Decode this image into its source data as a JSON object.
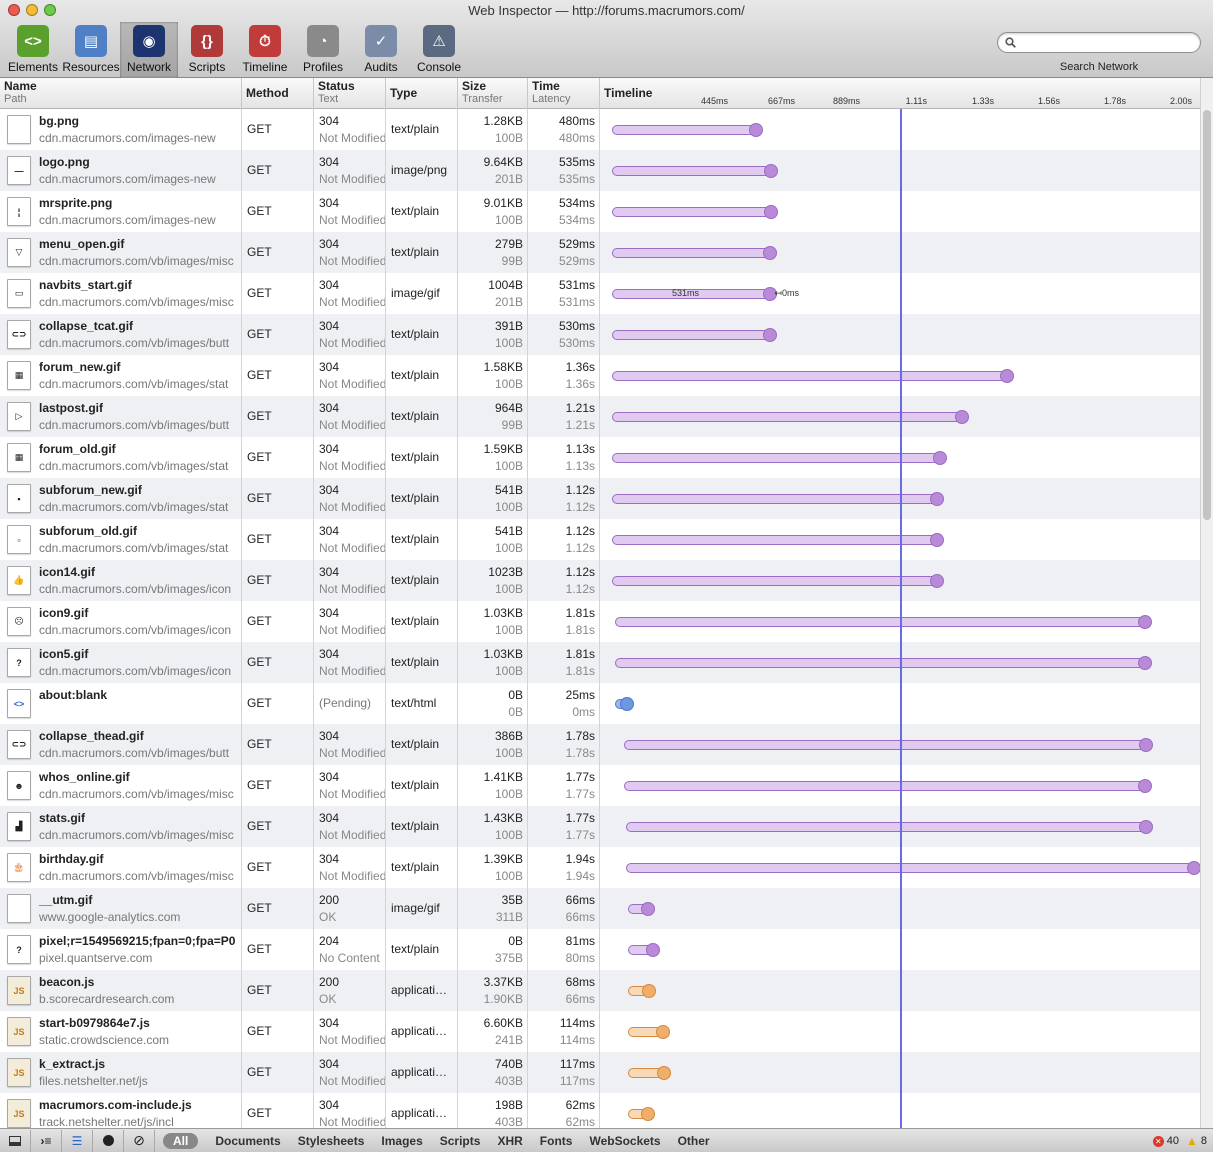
{
  "window": {
    "title": "Web Inspector — http://forums.macrumors.com/"
  },
  "toolbar": [
    {
      "label": "Elements",
      "icon": "elements-icon",
      "color": "#5aa02c",
      "glyph": "<>"
    },
    {
      "label": "Resources",
      "icon": "resources-icon",
      "color": "#4f7fc4",
      "glyph": "▤"
    },
    {
      "label": "Network",
      "icon": "network-icon",
      "color": "#1e3470",
      "glyph": "◉"
    },
    {
      "label": "Scripts",
      "icon": "scripts-icon",
      "color": "#b03a3a",
      "glyph": "{}"
    },
    {
      "label": "Timeline",
      "icon": "timeline-icon",
      "color": "#c23b3b",
      "glyph": "⏱"
    },
    {
      "label": "Profiles",
      "icon": "profiles-icon",
      "color": "#8a8a8a",
      "glyph": "◔"
    },
    {
      "label": "Audits",
      "icon": "audits-icon",
      "color": "#7a8ca8",
      "glyph": "✓"
    },
    {
      "label": "Console",
      "icon": "console-icon",
      "color": "#5a6a80",
      "glyph": "⚠"
    }
  ],
  "search": {
    "placeholder": "",
    "caption": "Search Network"
  },
  "columns": {
    "name": "Name",
    "path": "Path",
    "method": "Method",
    "status": "Status",
    "status_text": "Text",
    "type": "Type",
    "size": "Size",
    "transfer": "Transfer",
    "time": "Time",
    "latency": "Latency",
    "timeline": "Timeline"
  },
  "timeline_ticks": [
    "445ms",
    "667ms",
    "889ms",
    "1.11s",
    "1.33s",
    "1.56s",
    "1.78s",
    "2.00s"
  ],
  "resources": [
    {
      "name": "bg.png",
      "path": "cdn.macrumors.com/images-new",
      "method": "GET",
      "status": "304",
      "status_text": "Not Modified",
      "type": "text/plain",
      "size": "1.28KB",
      "transfer": "100B",
      "time": "480ms",
      "latency": "480ms",
      "bar": [
        0.02,
        0.26
      ],
      "color": "purple",
      "icon": "image-file-icon",
      "glyph": ""
    },
    {
      "name": "logo.png",
      "path": "cdn.macrumors.com/images-new",
      "method": "GET",
      "status": "304",
      "status_text": "Not Modified",
      "type": "image/png",
      "size": "9.64KB",
      "transfer": "201B",
      "time": "535ms",
      "latency": "535ms",
      "bar": [
        0.02,
        0.285
      ],
      "color": "purple",
      "icon": "image-file-icon",
      "glyph": "—"
    },
    {
      "name": "mrsprite.png",
      "path": "cdn.macrumors.com/images-new",
      "method": "GET",
      "status": "304",
      "status_text": "Not Modified",
      "type": "text/plain",
      "size": "9.01KB",
      "transfer": "100B",
      "time": "534ms",
      "latency": "534ms",
      "bar": [
        0.02,
        0.285
      ],
      "color": "purple",
      "icon": "image-file-icon",
      "glyph": "¦"
    },
    {
      "name": "menu_open.gif",
      "path": "cdn.macrumors.com/vb/images/misc",
      "method": "GET",
      "status": "304",
      "status_text": "Not Modified",
      "type": "text/plain",
      "size": "279B",
      "transfer": "99B",
      "time": "529ms",
      "latency": "529ms",
      "bar": [
        0.02,
        0.283
      ],
      "color": "purple",
      "icon": "image-file-icon",
      "glyph": "▽"
    },
    {
      "name": "navbits_start.gif",
      "path": "cdn.macrumors.com/vb/images/misc",
      "method": "GET",
      "status": "304",
      "status_text": "Not Modified",
      "type": "image/gif",
      "size": "1004B",
      "transfer": "201B",
      "time": "531ms",
      "latency": "531ms",
      "bar": [
        0.02,
        0.284
      ],
      "color": "purple",
      "icon": "image-file-icon",
      "glyph": "▭",
      "label_in": "531ms",
      "label_after": "0ms"
    },
    {
      "name": "collapse_tcat.gif",
      "path": "cdn.macrumors.com/vb/images/butt",
      "method": "GET",
      "status": "304",
      "status_text": "Not Modified",
      "type": "text/plain",
      "size": "391B",
      "transfer": "100B",
      "time": "530ms",
      "latency": "530ms",
      "bar": [
        0.02,
        0.284
      ],
      "color": "purple",
      "icon": "image-file-icon",
      "glyph": "⊂⊃"
    },
    {
      "name": "forum_new.gif",
      "path": "cdn.macrumors.com/vb/images/stat",
      "method": "GET",
      "status": "304",
      "status_text": "Not Modified",
      "type": "text/plain",
      "size": "1.58KB",
      "transfer": "100B",
      "time": "1.36s",
      "latency": "1.36s",
      "bar": [
        0.02,
        0.678
      ],
      "color": "purple",
      "icon": "image-file-icon",
      "glyph": "▦"
    },
    {
      "name": "lastpost.gif",
      "path": "cdn.macrumors.com/vb/images/butt",
      "method": "GET",
      "status": "304",
      "status_text": "Not Modified",
      "type": "text/plain",
      "size": "964B",
      "transfer": "99B",
      "time": "1.21s",
      "latency": "1.21s",
      "bar": [
        0.02,
        0.604
      ],
      "color": "purple",
      "icon": "image-file-icon",
      "glyph": "▷"
    },
    {
      "name": "forum_old.gif",
      "path": "cdn.macrumors.com/vb/images/stat",
      "method": "GET",
      "status": "304",
      "status_text": "Not Modified",
      "type": "text/plain",
      "size": "1.59KB",
      "transfer": "100B",
      "time": "1.13s",
      "latency": "1.13s",
      "bar": [
        0.02,
        0.566
      ],
      "color": "purple",
      "icon": "image-file-icon",
      "glyph": "▦"
    },
    {
      "name": "subforum_new.gif",
      "path": "cdn.macrumors.com/vb/images/stat",
      "method": "GET",
      "status": "304",
      "status_text": "Not Modified",
      "type": "text/plain",
      "size": "541B",
      "transfer": "100B",
      "time": "1.12s",
      "latency": "1.12s",
      "bar": [
        0.02,
        0.561
      ],
      "color": "purple",
      "icon": "image-file-icon",
      "glyph": "▪"
    },
    {
      "name": "subforum_old.gif",
      "path": "cdn.macrumors.com/vb/images/stat",
      "method": "GET",
      "status": "304",
      "status_text": "Not Modified",
      "type": "text/plain",
      "size": "541B",
      "transfer": "100B",
      "time": "1.12s",
      "latency": "1.12s",
      "bar": [
        0.02,
        0.561
      ],
      "color": "purple",
      "icon": "image-file-icon",
      "glyph": "▫"
    },
    {
      "name": "icon14.gif",
      "path": "cdn.macrumors.com/vb/images/icon",
      "method": "GET",
      "status": "304",
      "status_text": "Not Modified",
      "type": "text/plain",
      "size": "1023B",
      "transfer": "100B",
      "time": "1.12s",
      "latency": "1.12s",
      "bar": [
        0.02,
        0.561
      ],
      "color": "purple",
      "icon": "image-file-icon",
      "glyph": "👍"
    },
    {
      "name": "icon9.gif",
      "path": "cdn.macrumors.com/vb/images/icon",
      "method": "GET",
      "status": "304",
      "status_text": "Not Modified",
      "type": "text/plain",
      "size": "1.03KB",
      "transfer": "100B",
      "time": "1.81s",
      "latency": "1.81s",
      "bar": [
        0.025,
        0.908
      ],
      "color": "purple",
      "icon": "image-file-icon",
      "glyph": "☹"
    },
    {
      "name": "icon5.gif",
      "path": "cdn.macrumors.com/vb/images/icon",
      "method": "GET",
      "status": "304",
      "status_text": "Not Modified",
      "type": "text/plain",
      "size": "1.03KB",
      "transfer": "100B",
      "time": "1.81s",
      "latency": "1.81s",
      "bar": [
        0.025,
        0.908
      ],
      "color": "purple",
      "icon": "image-file-icon",
      "glyph": "?"
    },
    {
      "name": "about:blank",
      "path": "",
      "method": "GET",
      "status": "(Pending)",
      "status_text": "",
      "type": "text/html",
      "size": "0B",
      "transfer": "0B",
      "time": "25ms",
      "latency": "0ms",
      "bar": [
        0.025,
        0.045
      ],
      "color": "blue",
      "icon": "html-file-icon",
      "glyph": "<>"
    },
    {
      "name": "collapse_thead.gif",
      "path": "cdn.macrumors.com/vb/images/butt",
      "method": "GET",
      "status": "304",
      "status_text": "Not Modified",
      "type": "text/plain",
      "size": "386B",
      "transfer": "100B",
      "time": "1.78s",
      "latency": "1.78s",
      "bar": [
        0.04,
        0.91
      ],
      "color": "purple",
      "icon": "image-file-icon",
      "glyph": "⊂⊃"
    },
    {
      "name": "whos_online.gif",
      "path": "cdn.macrumors.com/vb/images/misc",
      "method": "GET",
      "status": "304",
      "status_text": "Not Modified",
      "type": "text/plain",
      "size": "1.41KB",
      "transfer": "100B",
      "time": "1.77s",
      "latency": "1.77s",
      "bar": [
        0.04,
        0.908
      ],
      "color": "purple",
      "icon": "image-file-icon",
      "glyph": "☻"
    },
    {
      "name": "stats.gif",
      "path": "cdn.macrumors.com/vb/images/misc",
      "method": "GET",
      "status": "304",
      "status_text": "Not Modified",
      "type": "text/plain",
      "size": "1.43KB",
      "transfer": "100B",
      "time": "1.77s",
      "latency": "1.77s",
      "bar": [
        0.043,
        0.91
      ],
      "color": "purple",
      "icon": "image-file-icon",
      "glyph": "▟"
    },
    {
      "name": "birthday.gif",
      "path": "cdn.macrumors.com/vb/images/misc",
      "method": "GET",
      "status": "304",
      "status_text": "Not Modified",
      "type": "text/plain",
      "size": "1.39KB",
      "transfer": "100B",
      "time": "1.94s",
      "latency": "1.94s",
      "bar": [
        0.043,
        0.99
      ],
      "color": "purple",
      "icon": "image-file-icon",
      "glyph": "🎂"
    },
    {
      "name": "__utm.gif",
      "path": "www.google-analytics.com",
      "method": "GET",
      "status": "200",
      "status_text": "OK",
      "type": "image/gif",
      "size": "35B",
      "transfer": "311B",
      "time": "66ms",
      "latency": "66ms",
      "bar": [
        0.047,
        0.08
      ],
      "color": "purple",
      "icon": "image-file-icon",
      "glyph": ""
    },
    {
      "name": "pixel;r=1549569215;fpan=0;fpa=P0",
      "path": "pixel.quantserve.com",
      "method": "GET",
      "status": "204",
      "status_text": "No Content",
      "type": "text/plain",
      "size": "0B",
      "transfer": "375B",
      "time": "81ms",
      "latency": "80ms",
      "bar": [
        0.047,
        0.088
      ],
      "color": "purple",
      "icon": "unknown-file-icon",
      "glyph": "?"
    },
    {
      "name": "beacon.js",
      "path": "b.scorecardresearch.com",
      "method": "GET",
      "status": "200",
      "status_text": "OK",
      "type": "application/javascript",
      "size": "3.37KB",
      "transfer": "1.90KB",
      "time": "68ms",
      "latency": "66ms",
      "bar": [
        0.047,
        0.082
      ],
      "color": "orange",
      "icon": "js-file-icon",
      "glyph": "JS"
    },
    {
      "name": "start-b0979864e7.js",
      "path": "static.crowdscience.com",
      "method": "GET",
      "status": "304",
      "status_text": "Not Modified",
      "type": "application/javascript",
      "size": "6.60KB",
      "transfer": "241B",
      "time": "114ms",
      "latency": "114ms",
      "bar": [
        0.047,
        0.105
      ],
      "color": "orange",
      "icon": "js-file-icon",
      "glyph": "JS"
    },
    {
      "name": "k_extract.js",
      "path": "files.netshelter.net/js",
      "method": "GET",
      "status": "304",
      "status_text": "Not Modified",
      "type": "application/javascript",
      "size": "740B",
      "transfer": "403B",
      "time": "117ms",
      "latency": "117ms",
      "bar": [
        0.047,
        0.107
      ],
      "color": "orange",
      "icon": "js-file-icon",
      "glyph": "JS"
    },
    {
      "name": "macrumors.com-include.js",
      "path": "track.netshelter.net/js/incl",
      "method": "GET",
      "status": "304",
      "status_text": "Not Modified",
      "type": "application/javascript",
      "size": "198B",
      "transfer": "403B",
      "time": "62ms",
      "latency": "62ms",
      "bar": [
        0.047,
        0.08
      ],
      "color": "orange",
      "icon": "js-file-icon",
      "glyph": "JS"
    }
  ],
  "bar_colors": {
    "purple": {
      "fill": "#e0caef",
      "end": "#b88ad8",
      "border": "#9a6cc4"
    },
    "blue": {
      "fill": "#9ab8ef",
      "end": "#7098e0",
      "border": "#4f78c8"
    },
    "orange": {
      "fill": "#f7d9b8",
      "end": "#efae6c",
      "border": "#d58a3e"
    }
  },
  "statusbar": {
    "filters": [
      "Documents",
      "Stylesheets",
      "Images",
      "Scripts",
      "XHR",
      "Fonts",
      "WebSockets",
      "Other"
    ],
    "all_label": "All",
    "errors": "40",
    "warnings": "8"
  }
}
